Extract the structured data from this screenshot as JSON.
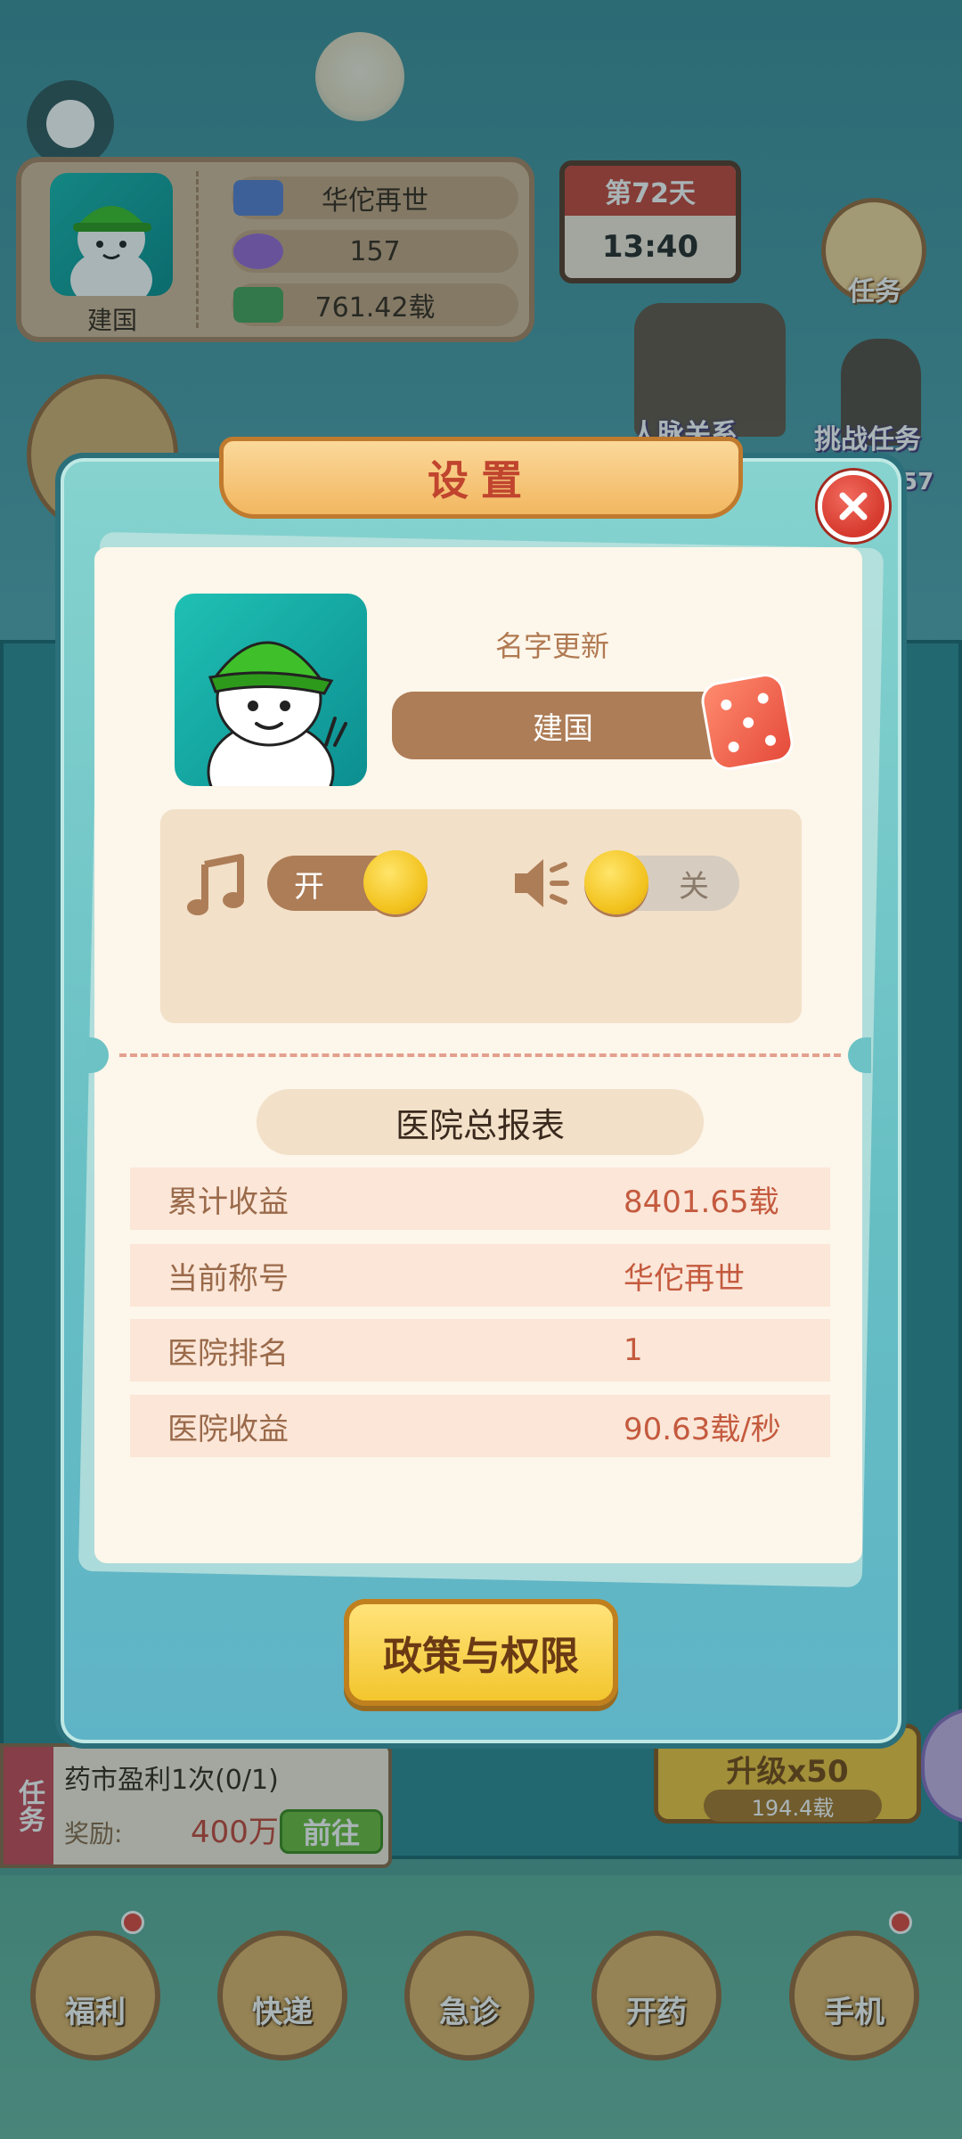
{
  "background": {
    "profile": {
      "name": "建国",
      "title": "华佗再世",
      "gems": "157",
      "money": "761.42载"
    },
    "day_card": {
      "day": "第72天",
      "time": "13:40"
    },
    "task_button_label": "任务",
    "relations_label": "人脉关系",
    "challenge_label": "挑战任务",
    "challenge_count": "57",
    "task_bar": {
      "flag": "任务",
      "text": "药市盈利1次(0/1)",
      "reward_label": "奖励:",
      "reward_value": "400万",
      "go_label": "前往"
    },
    "upgrade": {
      "label": "升级x50",
      "cost": "194.4载"
    },
    "bottom_nav": [
      {
        "label": "福利",
        "icon": "gift-icon",
        "badge": true
      },
      {
        "label": "快递",
        "icon": "mailbox-icon",
        "badge": false
      },
      {
        "label": "急诊",
        "icon": "medkit-icon",
        "badge": false
      },
      {
        "label": "开药",
        "icon": "pills-icon",
        "badge": false
      },
      {
        "label": "手机",
        "icon": "phone-icon",
        "badge": true
      }
    ]
  },
  "modal": {
    "title": "设置",
    "name_hint": "名字更新",
    "name_value": "建国",
    "music_toggle": {
      "label": "开",
      "on": true
    },
    "sound_toggle": {
      "label": "关",
      "on": false
    },
    "report_title": "医院总报表",
    "report_rows": [
      {
        "label": "累计收益",
        "value": "8401.65载"
      },
      {
        "label": "当前称号",
        "value": "华佗再世"
      },
      {
        "label": "医院排名",
        "value": "1"
      },
      {
        "label": "医院收益",
        "value": "90.63载/秒"
      }
    ],
    "policy_button": "政策与权限"
  },
  "colors": {
    "modal_bg": "#66bec3",
    "paper": "#fdf6ea",
    "accent_red": "#c0442e",
    "brown": "#ad7d57",
    "gold": "#f3c62e"
  }
}
